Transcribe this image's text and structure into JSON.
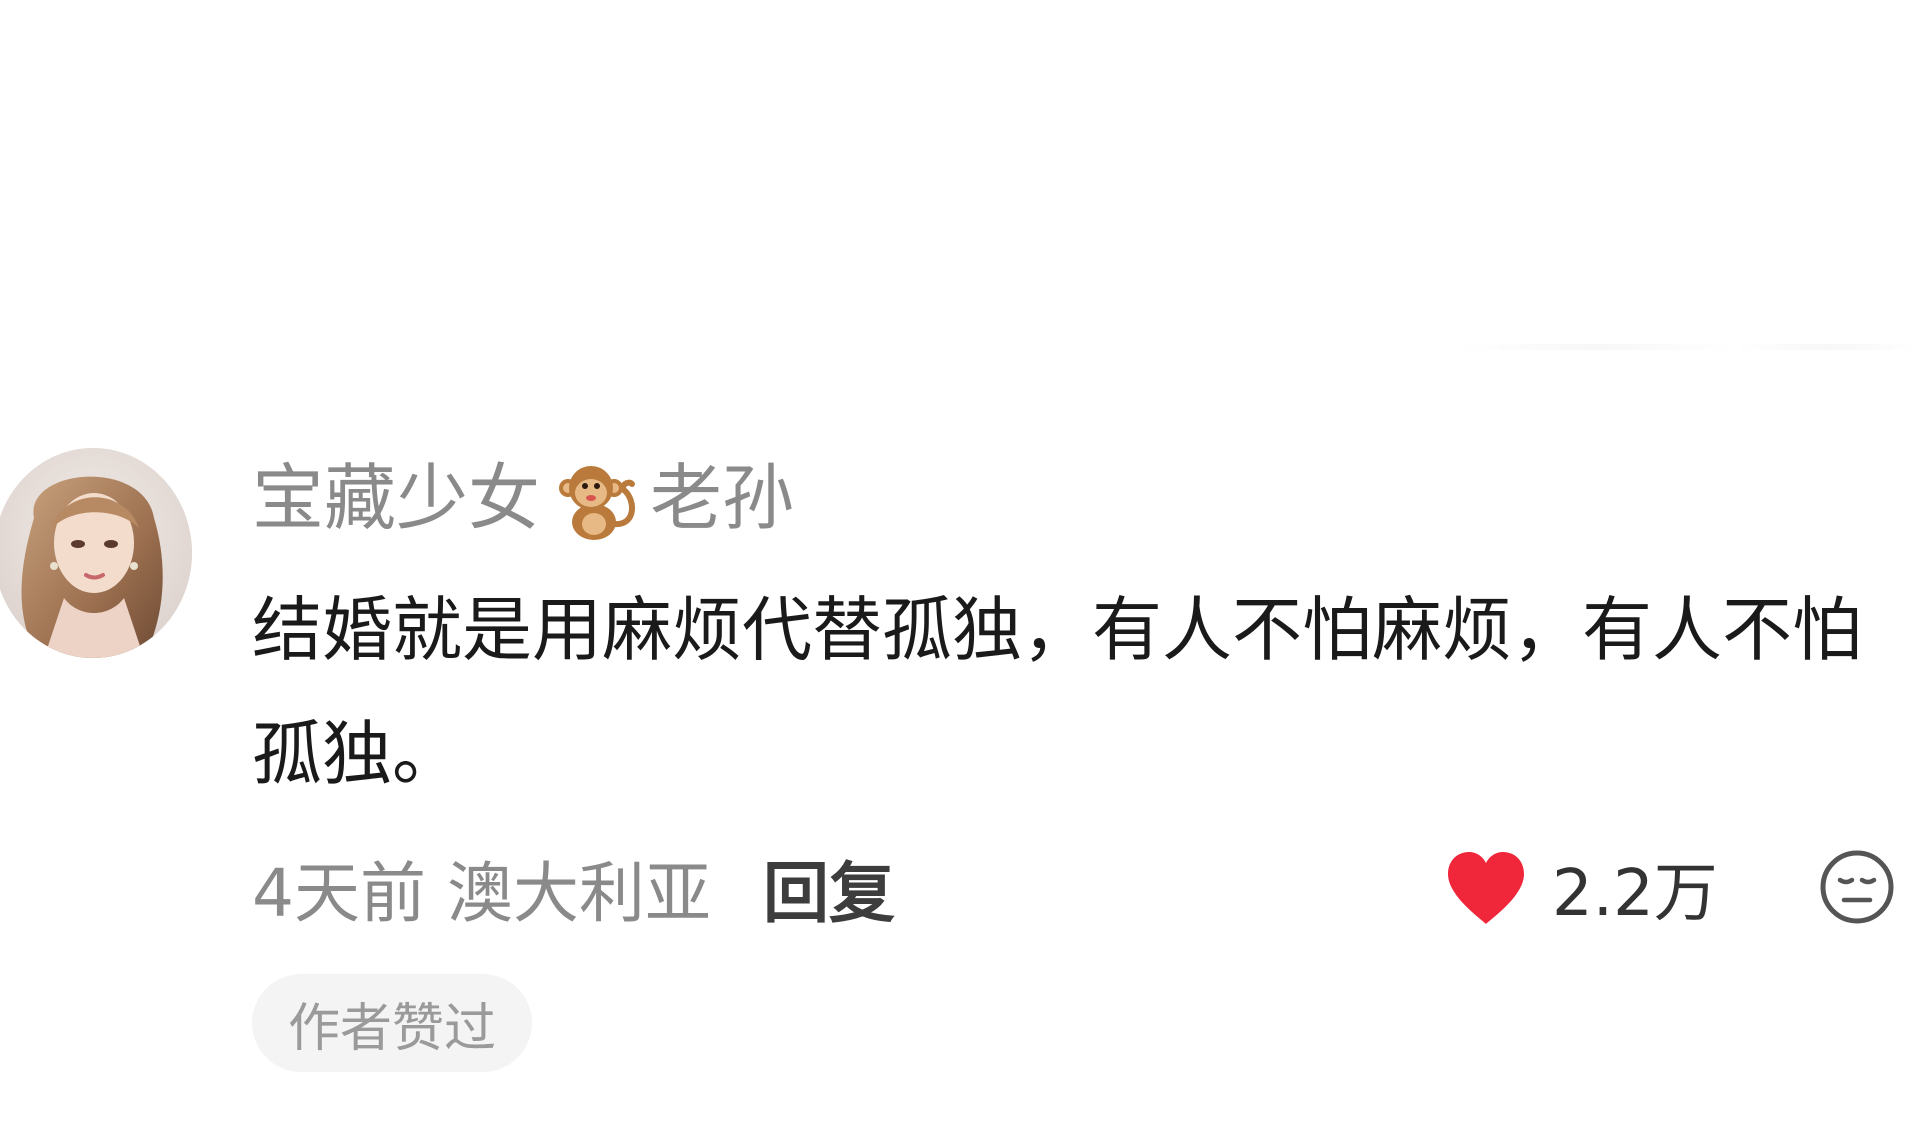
{
  "comment": {
    "username_before": "宝藏少女",
    "username_emoji": "monkey-emoji",
    "username_after": "老孙",
    "content": "结婚就是用麻烦代替孤独，有人不怕麻烦，有人不怕孤独。",
    "time_location": "4天前 澳大利亚",
    "reply_label": "回复",
    "like_count": "2.2万",
    "author_liked_tag": "作者赞过",
    "like_color": "#f0263a"
  }
}
